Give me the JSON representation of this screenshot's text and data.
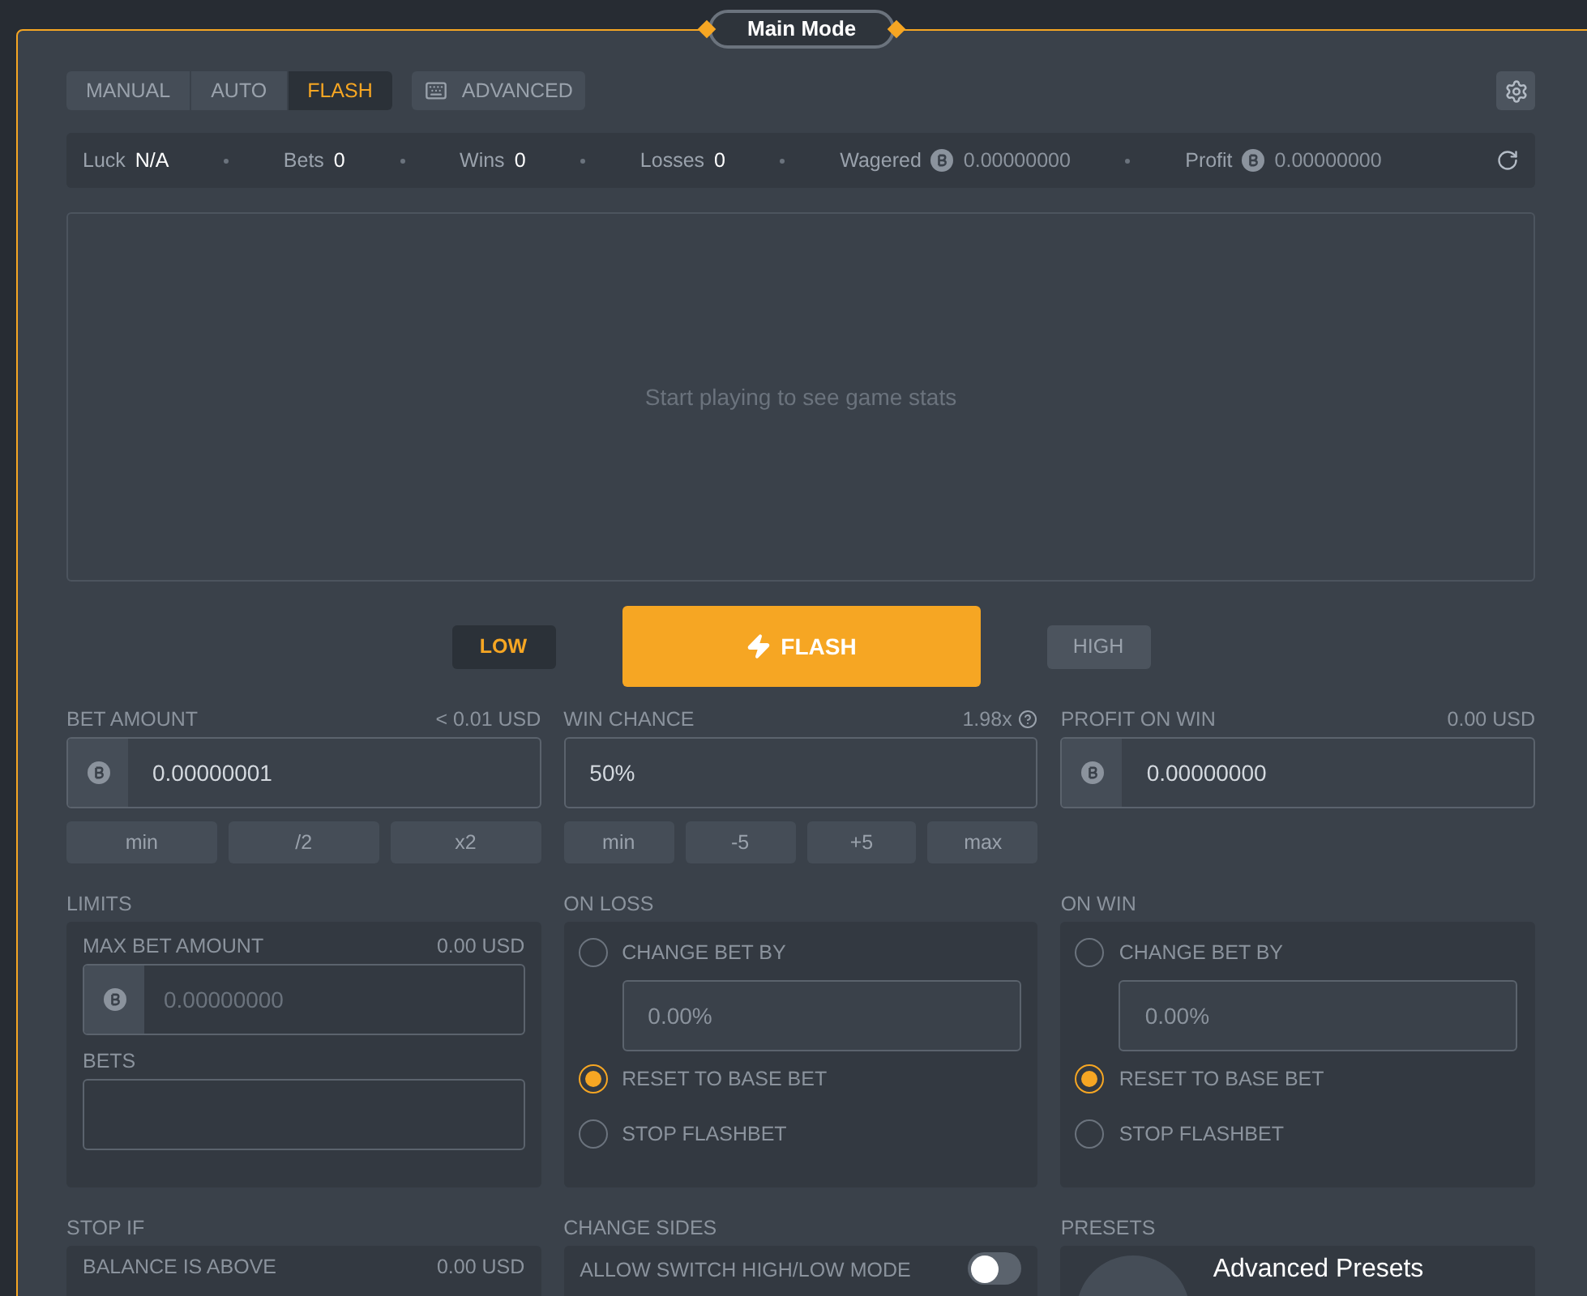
{
  "header": {
    "title": "Main Mode"
  },
  "mode_tabs": [
    {
      "label": "MANUAL",
      "selected": false
    },
    {
      "label": "AUTO",
      "selected": false
    },
    {
      "label": "FLASH",
      "selected": true
    }
  ],
  "advanced_button": {
    "label": "ADVANCED"
  },
  "stats": [
    {
      "label": "Luck",
      "value": "N/A",
      "coin": false
    },
    {
      "label": "Bets",
      "value": "0",
      "coin": false
    },
    {
      "label": "Wins",
      "value": "0",
      "coin": false
    },
    {
      "label": "Losses",
      "value": "0",
      "coin": false
    },
    {
      "label": "Wagered",
      "value": "0.00000000",
      "coin": true
    },
    {
      "label": "Profit",
      "value": "0.00000000",
      "coin": true
    }
  ],
  "game_stats": {
    "empty_message": "Start playing to see game stats"
  },
  "sides": [
    {
      "label": "LOW",
      "selected": true
    },
    {
      "label": "HIGH",
      "selected": false
    }
  ],
  "flash_button": {
    "label": "FLASH"
  },
  "bet_amount": {
    "label": "BET AMOUNT",
    "note": "< 0.01 USD",
    "value": "0.00000001",
    "buttons": [
      "min",
      "/2",
      "x2"
    ]
  },
  "win_chance": {
    "label": "WIN CHANCE",
    "note": "1.98x",
    "value": "50%",
    "buttons": [
      "min",
      "-5",
      "+5",
      "max"
    ]
  },
  "profit_on_win": {
    "label": "PROFIT ON WIN",
    "note": "0.00 USD",
    "value": "0.00000000"
  },
  "limits": {
    "label": "LIMITS",
    "max_bet": {
      "label": "MAX BET AMOUNT",
      "note": "0.00 USD",
      "placeholder": "0.00000000"
    },
    "bets": {
      "label": "BETS"
    }
  },
  "on_loss": {
    "label": "ON LOSS",
    "options": [
      {
        "label": "CHANGE BET BY",
        "selected": false,
        "placeholder": "0.00%"
      },
      {
        "label": "RESET TO BASE BET",
        "selected": true
      },
      {
        "label": "STOP FLASHBET",
        "selected": false
      }
    ]
  },
  "on_win": {
    "label": "ON WIN",
    "options": [
      {
        "label": "CHANGE BET BY",
        "selected": false,
        "placeholder": "0.00%"
      },
      {
        "label": "RESET TO BASE BET",
        "selected": true
      },
      {
        "label": "STOP FLASHBET",
        "selected": false
      }
    ]
  },
  "stop_if": {
    "label": "STOP IF",
    "balance_above": {
      "label": "BALANCE IS ABOVE",
      "note": "0.00 USD"
    }
  },
  "change_sides": {
    "label": "CHANGE SIDES",
    "switch": {
      "label": "ALLOW SWITCH HIGH/LOW MODE",
      "on": false
    }
  },
  "presets": {
    "label": "PRESETS",
    "title": "Advanced Presets"
  }
}
